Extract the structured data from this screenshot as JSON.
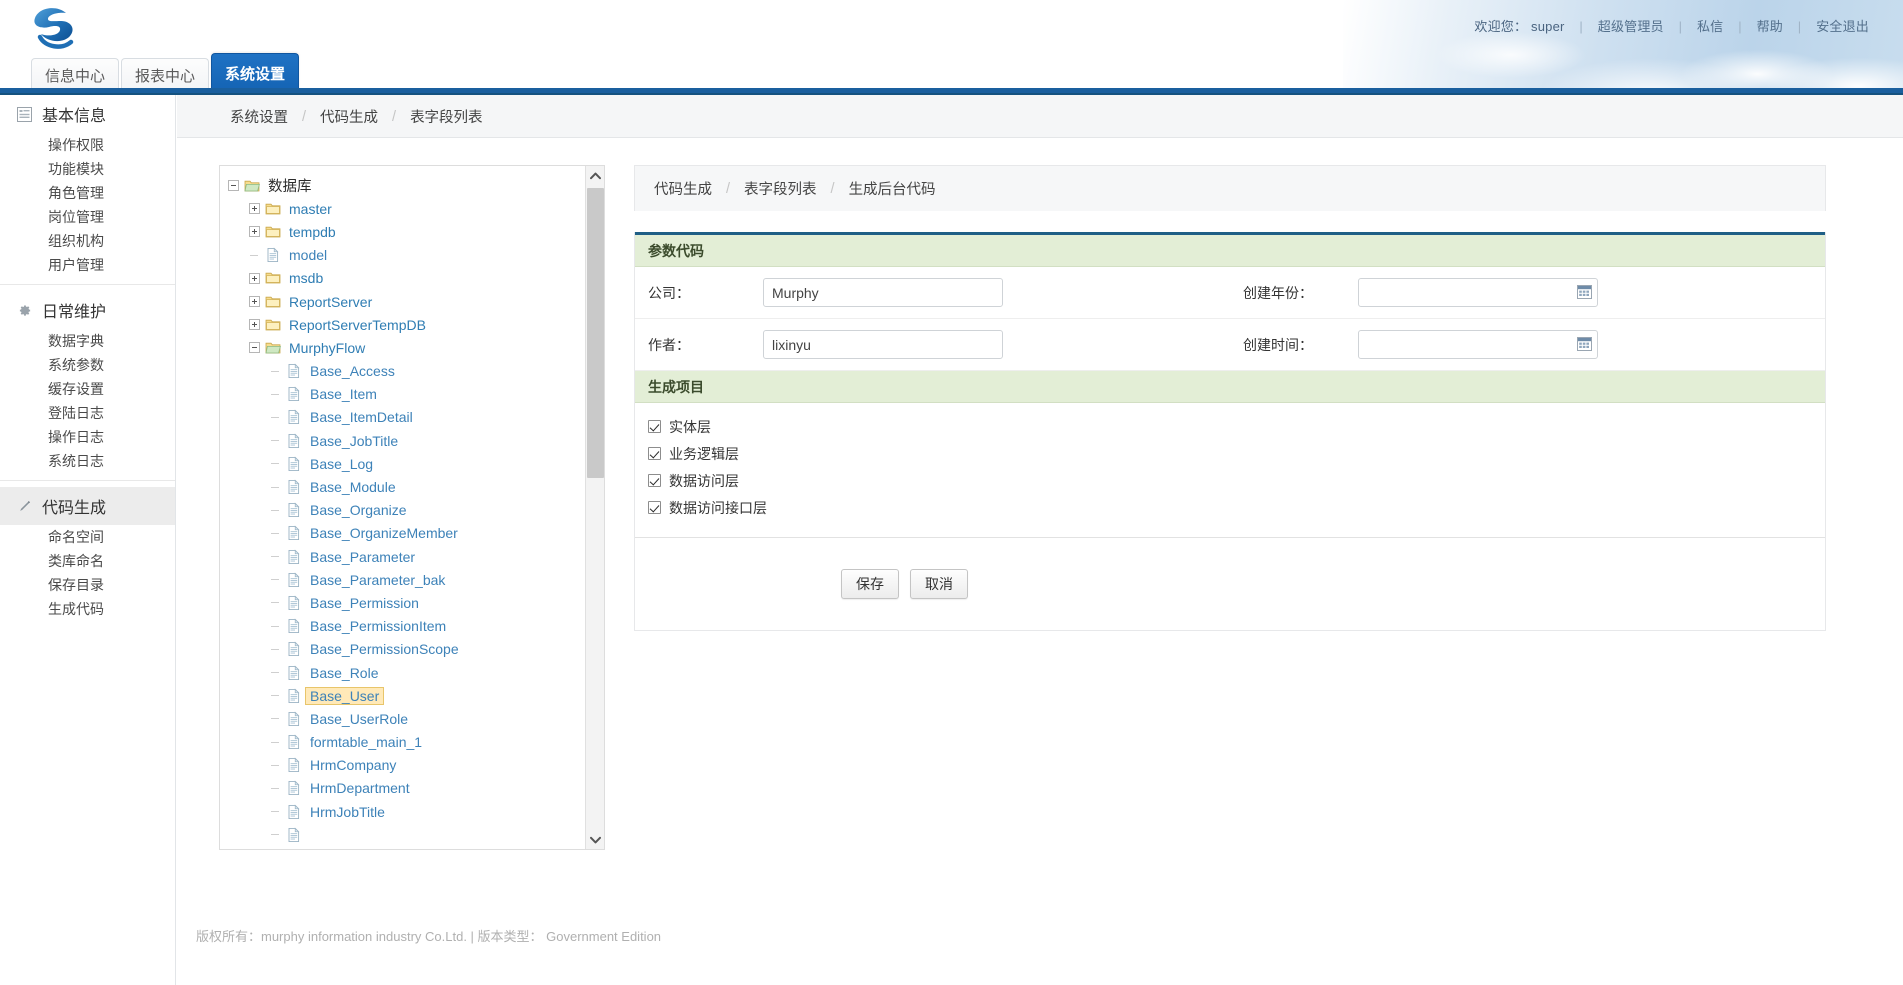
{
  "header": {
    "logo_icon": "cloud-swirl-logo",
    "user_prefix": "欢迎您：",
    "user_name": "super",
    "role": "超级管理员",
    "message": "私信",
    "help": "帮助",
    "logout": "安全退出",
    "separator": "|"
  },
  "tabs": [
    {
      "label": "信息中心",
      "active": false
    },
    {
      "label": "报表中心",
      "active": false
    },
    {
      "label": "系统设置",
      "active": true
    }
  ],
  "sidebar": {
    "groups": [
      {
        "label": "基本信息",
        "icon": "list-icon",
        "selected": false,
        "items": [
          "操作权限",
          "功能模块",
          "角色管理",
          "岗位管理",
          "组织机构",
          "用户管理"
        ]
      },
      {
        "label": "日常维护",
        "icon": "gear-icon",
        "selected": false,
        "items": [
          "数据字典",
          "系统参数",
          "缓存设置",
          "登陆日志",
          "操作日志",
          "系统日志"
        ]
      },
      {
        "label": "代码生成",
        "icon": "pencil-icon",
        "selected": true,
        "items": [
          "命名空间",
          "类库命名",
          "保存目录",
          "生成代码"
        ]
      }
    ]
  },
  "breadcrumb": {
    "items": [
      "系统设置",
      "代码生成",
      "表字段列表"
    ],
    "separator": "/"
  },
  "form_breadcrumb": {
    "items": [
      "代码生成",
      "表字段列表",
      "生成后台代码"
    ],
    "separator": "/"
  },
  "tree": {
    "nodes": [
      {
        "label": "数据库",
        "depth": 0,
        "type": "folder-open",
        "toggle": "minus",
        "root": true,
        "selected": false
      },
      {
        "label": "master",
        "depth": 1,
        "type": "folder",
        "toggle": "plus",
        "selected": false
      },
      {
        "label": "tempdb",
        "depth": 1,
        "type": "folder",
        "toggle": "plus",
        "selected": false
      },
      {
        "label": "model",
        "depth": 1,
        "type": "file",
        "toggle": "dash",
        "selected": false
      },
      {
        "label": "msdb",
        "depth": 1,
        "type": "folder",
        "toggle": "plus",
        "selected": false
      },
      {
        "label": "ReportServer",
        "depth": 1,
        "type": "folder",
        "toggle": "plus",
        "selected": false
      },
      {
        "label": "ReportServerTempDB",
        "depth": 1,
        "type": "folder",
        "toggle": "plus",
        "selected": false
      },
      {
        "label": "MurphyFlow",
        "depth": 1,
        "type": "folder-open",
        "toggle": "minus",
        "selected": false
      },
      {
        "label": "Base_Access",
        "depth": 2,
        "type": "file",
        "toggle": "dash",
        "selected": false
      },
      {
        "label": "Base_Item",
        "depth": 2,
        "type": "file",
        "toggle": "dash",
        "selected": false
      },
      {
        "label": "Base_ItemDetail",
        "depth": 2,
        "type": "file",
        "toggle": "dash",
        "selected": false
      },
      {
        "label": "Base_JobTitle",
        "depth": 2,
        "type": "file",
        "toggle": "dash",
        "selected": false
      },
      {
        "label": "Base_Log",
        "depth": 2,
        "type": "file",
        "toggle": "dash",
        "selected": false
      },
      {
        "label": "Base_Module",
        "depth": 2,
        "type": "file",
        "toggle": "dash",
        "selected": false
      },
      {
        "label": "Base_Organize",
        "depth": 2,
        "type": "file",
        "toggle": "dash",
        "selected": false
      },
      {
        "label": "Base_OrganizeMember",
        "depth": 2,
        "type": "file",
        "toggle": "dash",
        "selected": false
      },
      {
        "label": "Base_Parameter",
        "depth": 2,
        "type": "file",
        "toggle": "dash",
        "selected": false
      },
      {
        "label": "Base_Parameter_bak",
        "depth": 2,
        "type": "file",
        "toggle": "dash",
        "selected": false
      },
      {
        "label": "Base_Permission",
        "depth": 2,
        "type": "file",
        "toggle": "dash",
        "selected": false
      },
      {
        "label": "Base_PermissionItem",
        "depth": 2,
        "type": "file",
        "toggle": "dash",
        "selected": false
      },
      {
        "label": "Base_PermissionScope",
        "depth": 2,
        "type": "file",
        "toggle": "dash",
        "selected": false
      },
      {
        "label": "Base_Role",
        "depth": 2,
        "type": "file",
        "toggle": "dash",
        "selected": false
      },
      {
        "label": "Base_User",
        "depth": 2,
        "type": "file",
        "toggle": "dash",
        "selected": true
      },
      {
        "label": "Base_UserRole",
        "depth": 2,
        "type": "file",
        "toggle": "dash",
        "selected": false
      },
      {
        "label": "formtable_main_1",
        "depth": 2,
        "type": "file",
        "toggle": "dash",
        "selected": false
      },
      {
        "label": "HrmCompany",
        "depth": 2,
        "type": "file",
        "toggle": "dash",
        "selected": false
      },
      {
        "label": "HrmDepartment",
        "depth": 2,
        "type": "file",
        "toggle": "dash",
        "selected": false
      },
      {
        "label": "HrmJobTitle",
        "depth": 2,
        "type": "file",
        "toggle": "dash",
        "selected": false
      },
      {
        "label": "",
        "depth": 2,
        "type": "file",
        "toggle": "dash",
        "selected": false
      }
    ],
    "scrollbar": {
      "up_icon": "chevron-up-icon",
      "down_icon": "chevron-down-icon"
    }
  },
  "form": {
    "section_params": {
      "title": "参数代码",
      "fields": [
        {
          "label": "公司：",
          "value": "Murphy",
          "placeholder": "",
          "kind": "text",
          "name": "company"
        },
        {
          "label": "创建年份：",
          "value": "",
          "placeholder": "",
          "kind": "date",
          "name": "create-year"
        },
        {
          "label": "作者：",
          "value": "lixinyu",
          "placeholder": "",
          "kind": "text",
          "name": "author"
        },
        {
          "label": "创建时间：",
          "value": "",
          "placeholder": "",
          "kind": "date",
          "name": "create-time"
        }
      ]
    },
    "section_items": {
      "title": "生成项目",
      "checkboxes": [
        {
          "label": "实体层",
          "checked": true
        },
        {
          "label": "业务逻辑层",
          "checked": true
        },
        {
          "label": "数据访问层",
          "checked": true
        },
        {
          "label": "数据访问接口层",
          "checked": true
        }
      ]
    },
    "buttons": [
      {
        "label": "保存",
        "name": "save-button"
      },
      {
        "label": "取消",
        "name": "cancel-button"
      }
    ]
  },
  "footer": {
    "text": "版权所有：murphy information industry Co.Ltd. | 版本类型： Government Edition"
  },
  "colors": {
    "accent_blue": "#1463b3",
    "rule_blue": "#1a5f9e",
    "section_green": "#e3eed6",
    "section_topline": "#1f5f86",
    "tree_link": "#3d82b8",
    "selected_bg": "#ffe9b8"
  }
}
